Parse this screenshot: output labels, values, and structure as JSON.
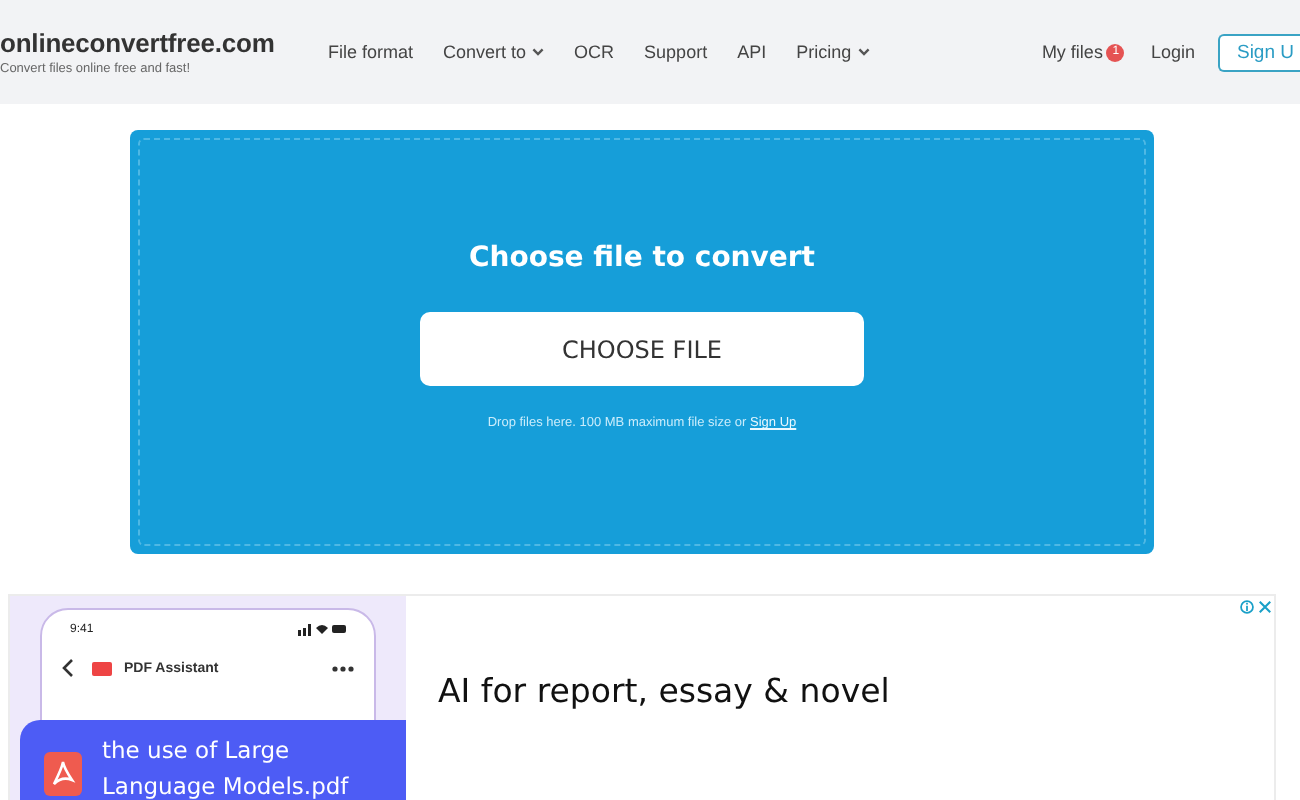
{
  "header": {
    "logo": "onlineconvertfree.com",
    "tagline": "Convert files online free and fast!",
    "nav": [
      {
        "label": "File format",
        "dropdown": false
      },
      {
        "label": "Convert to",
        "dropdown": true
      },
      {
        "label": "OCR",
        "dropdown": false
      },
      {
        "label": "Support",
        "dropdown": false
      },
      {
        "label": "API",
        "dropdown": false
      },
      {
        "label": "Pricing",
        "dropdown": true
      }
    ],
    "my_files": {
      "label": "My files",
      "badge": "1"
    },
    "login": "Login",
    "signup": "Sign U"
  },
  "upload": {
    "title": "Choose file to convert",
    "button": "CHOOSE FILE",
    "hint": "Drop files here. 100 MB maximum file size or ",
    "hint_link": "Sign Up"
  },
  "ad": {
    "phone": {
      "time": "9:41",
      "app_title": "PDF Assistant",
      "file_name": "the use of Large Language Models.pdf"
    },
    "headline": "AI for report, essay & novel"
  }
}
